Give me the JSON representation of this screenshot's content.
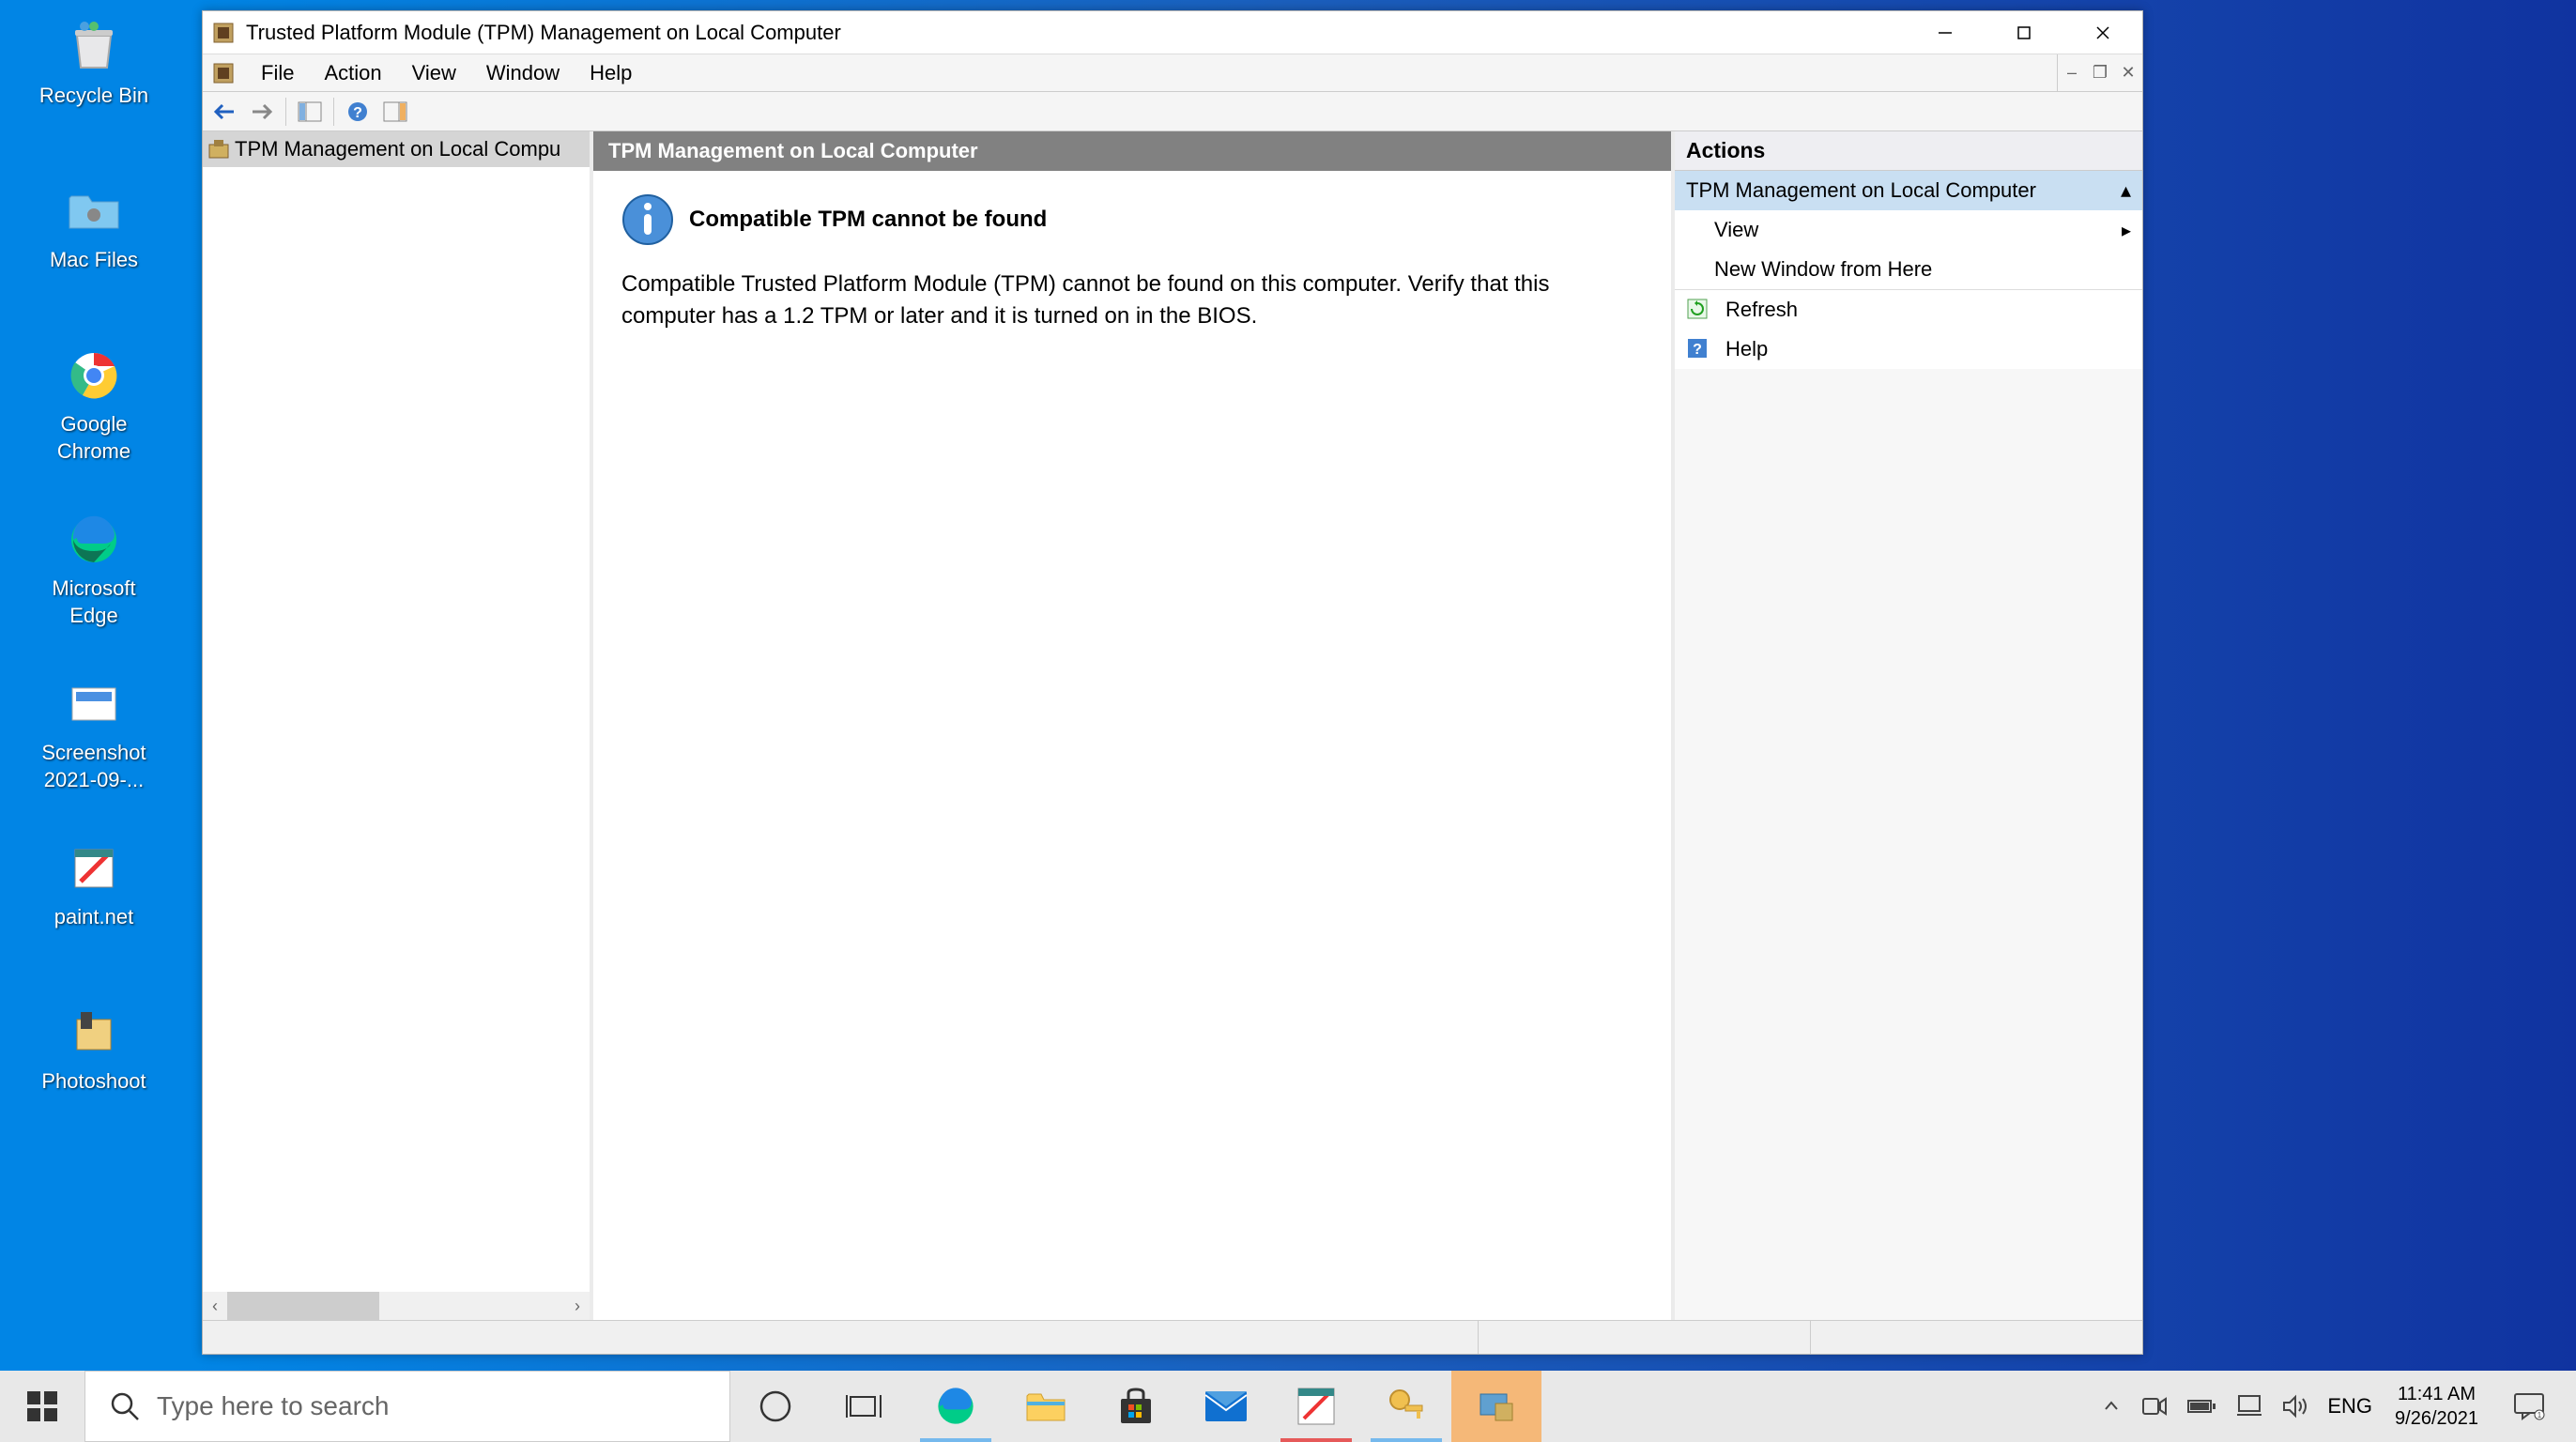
{
  "desktop": {
    "icons": [
      {
        "label": "Recycle Bin"
      },
      {
        "label": "Mac Files"
      },
      {
        "label": "Google Chrome"
      },
      {
        "label": "Microsoft Edge"
      },
      {
        "label": "Screenshot 2021-09-..."
      },
      {
        "label": "paint.net"
      },
      {
        "label": "Photoshoot"
      }
    ]
  },
  "window": {
    "title": "Trusted Platform Module (TPM) Management on Local Computer",
    "menubar": {
      "file": "File",
      "action": "Action",
      "view": "View",
      "window": "Window",
      "help": "Help"
    },
    "tree": {
      "item0": "TPM Management on Local Compu"
    },
    "content": {
      "header": "TPM Management on Local Computer",
      "info_title": "Compatible TPM cannot be found",
      "info_text": "Compatible Trusted Platform Module (TPM) cannot be found on this computer. Verify that this computer has a 1.2 TPM or later and it is turned on in the BIOS."
    },
    "actions": {
      "header": "Actions",
      "group": "TPM Management on Local Computer",
      "view": "View",
      "new_window": "New Window from Here",
      "refresh": "Refresh",
      "help": "Help"
    }
  },
  "taskbar": {
    "search_placeholder": "Type here to search",
    "lang": "ENG",
    "time": "11:41 AM",
    "date": "9/26/2021"
  }
}
